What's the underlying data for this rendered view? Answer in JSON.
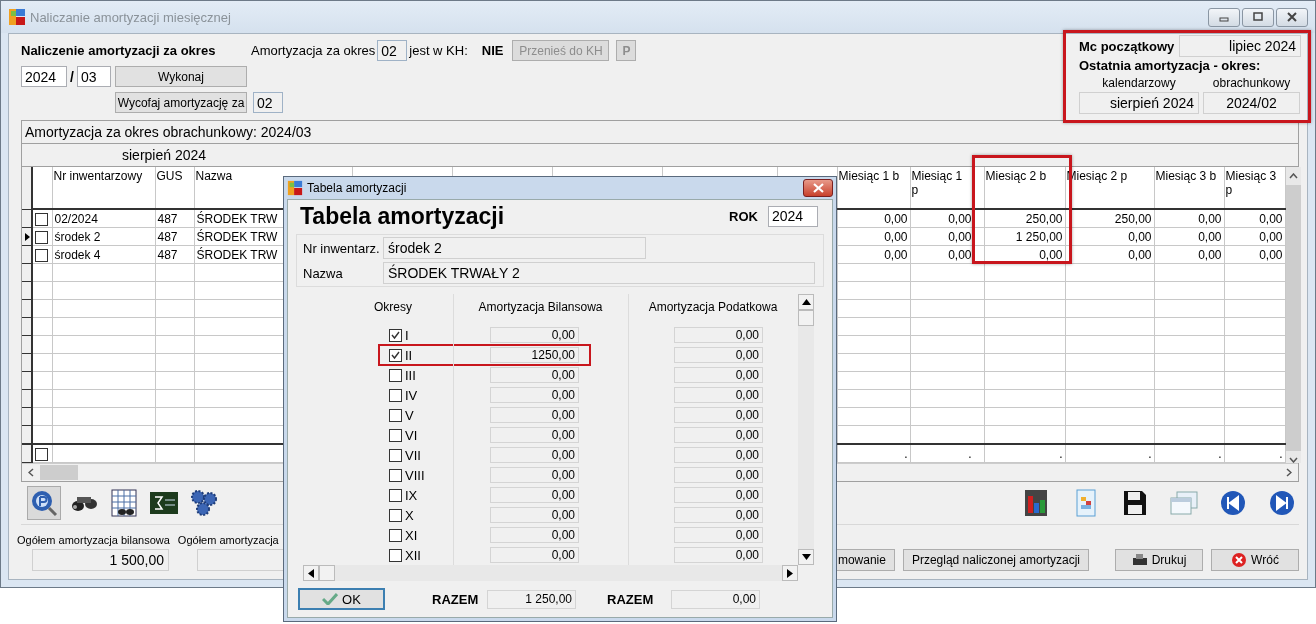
{
  "window": {
    "title": "Naliczanie amortyzacji miesięcznej"
  },
  "header": {
    "title": "Naliczenie amortyzacji za okres",
    "period_label": "Amortyzacja za okres",
    "period": "02",
    "kh_label": "jest w KH:",
    "kh_status": "NIE",
    "transfer_button": {
      "label": "Przenieś do KH",
      "disabled": true
    },
    "p_button": {
      "label": "P",
      "disabled": true
    },
    "year": "2024",
    "separator": "/",
    "month": "03",
    "run_button": "Wykonaj",
    "undo_button": "Wycofaj  amortyzację za",
    "undo_period": "02"
  },
  "start_panel": {
    "start_label": "Mc początkowy",
    "start_value": "lipiec 2024",
    "last_label": "Ostatnia amortyzacja - okres:",
    "calendar_label": "kalendarzowy",
    "accounting_label": "obrachunkowy",
    "calendar_value": "sierpień 2024",
    "accounting_value": "2024/02"
  },
  "grid": {
    "caption": "Amortyzacja za okres obrachunkowy: 2024/03",
    "group_label": "sierpień 2024",
    "columns": [
      "Nr inwentarzowy",
      "GUS",
      "Nazwa",
      "Miesiąc 1 b",
      "Miesiąc 1 p",
      "Miesiąc 2 b",
      "Miesiąc 2 p",
      "Miesiąc 3 b",
      "Miesiąc 3 p"
    ],
    "rows": [
      {
        "checked": false,
        "selected": false,
        "cells": [
          "02/2024",
          "487",
          "ŚRODEK TRW",
          "0,00",
          "0,00",
          "250,00",
          "250,00",
          "0,00",
          "0,00"
        ]
      },
      {
        "checked": false,
        "selected": true,
        "cells": [
          "środek 2",
          "487",
          "ŚRODEK TRW",
          "0,00",
          "0,00",
          "1 250,00",
          "0,00",
          "0,00",
          "0,00"
        ]
      },
      {
        "checked": false,
        "selected": false,
        "cells": [
          "środek 4",
          "487",
          "ŚRODEK TRW",
          "0,00",
          "0,00",
          "0,00",
          "0,00",
          "0,00",
          "0,00"
        ]
      }
    ],
    "summary": {
      "checked": false,
      "cells": [
        ".",
        ".",
        ".",
        ".",
        ".",
        "."
      ]
    }
  },
  "toolbar_left": [
    {
      "kind": "preview",
      "pressed": true
    },
    {
      "kind": "binoculars",
      "pressed": false
    },
    {
      "kind": "table",
      "pressed": false
    },
    {
      "kind": "sigma",
      "pressed": false
    },
    {
      "kind": "gears",
      "pressed": false
    }
  ],
  "toolbar_right": [
    {
      "kind": "chart"
    },
    {
      "kind": "document"
    },
    {
      "kind": "save"
    },
    {
      "kind": "windows"
    },
    {
      "kind": "previous"
    },
    {
      "kind": "next"
    }
  ],
  "totals": {
    "balance_label": "Ogółem amortyzacja bilansowa",
    "balance_value": "1 500,00",
    "tax_label": "Ogółem amortyzacja"
  },
  "buttons": [
    {
      "label": "mowanie",
      "kind": "plain"
    },
    {
      "label": "Przegląd naliczonej amortyzacji",
      "kind": "plain"
    },
    {
      "label": "Drukuj",
      "kind": "print"
    },
    {
      "label": "Wróć",
      "kind": "close"
    }
  ],
  "dialog": {
    "title": "Tabela amortyzacji",
    "heading": "Tabela amortyzacji",
    "year_label": "ROK",
    "year": "2024",
    "inv_label": "Nr inwentarz.",
    "inv_value": "środek 2",
    "name_label": "Nazwa",
    "name_value": "ŚRODEK TRWAŁY 2",
    "col_periods": "Okresy",
    "col_balance": "Amortyzacja Bilansowa",
    "col_tax": "Amortyzacja Podatkowa",
    "periods": [
      {
        "label": "I",
        "checked": true,
        "balance": "0,00",
        "tax": "0,00"
      },
      {
        "label": "II",
        "checked": true,
        "balance": "1250,00",
        "tax": "0,00"
      },
      {
        "label": "III",
        "checked": false,
        "balance": "0,00",
        "tax": "0,00"
      },
      {
        "label": "IV",
        "checked": false,
        "balance": "0,00",
        "tax": "0,00"
      },
      {
        "label": "V",
        "checked": false,
        "balance": "0,00",
        "tax": "0,00"
      },
      {
        "label": "VI",
        "checked": false,
        "balance": "0,00",
        "tax": "0,00"
      },
      {
        "label": "VII",
        "checked": false,
        "balance": "0,00",
        "tax": "0,00"
      },
      {
        "label": "VIII",
        "checked": false,
        "balance": "0,00",
        "tax": "0,00"
      },
      {
        "label": "IX",
        "checked": false,
        "balance": "0,00",
        "tax": "0,00"
      },
      {
        "label": "X",
        "checked": false,
        "balance": "0,00",
        "tax": "0,00"
      },
      {
        "label": "XI",
        "checked": false,
        "balance": "0,00",
        "tax": "0,00"
      },
      {
        "label": "XII",
        "checked": false,
        "balance": "0,00",
        "tax": "0,00"
      }
    ],
    "ok_button": "OK",
    "total_label_balance": "RAZEM",
    "total_balance": "1 250,00",
    "total_label_tax": "RAZEM",
    "total_tax": "0,00"
  }
}
